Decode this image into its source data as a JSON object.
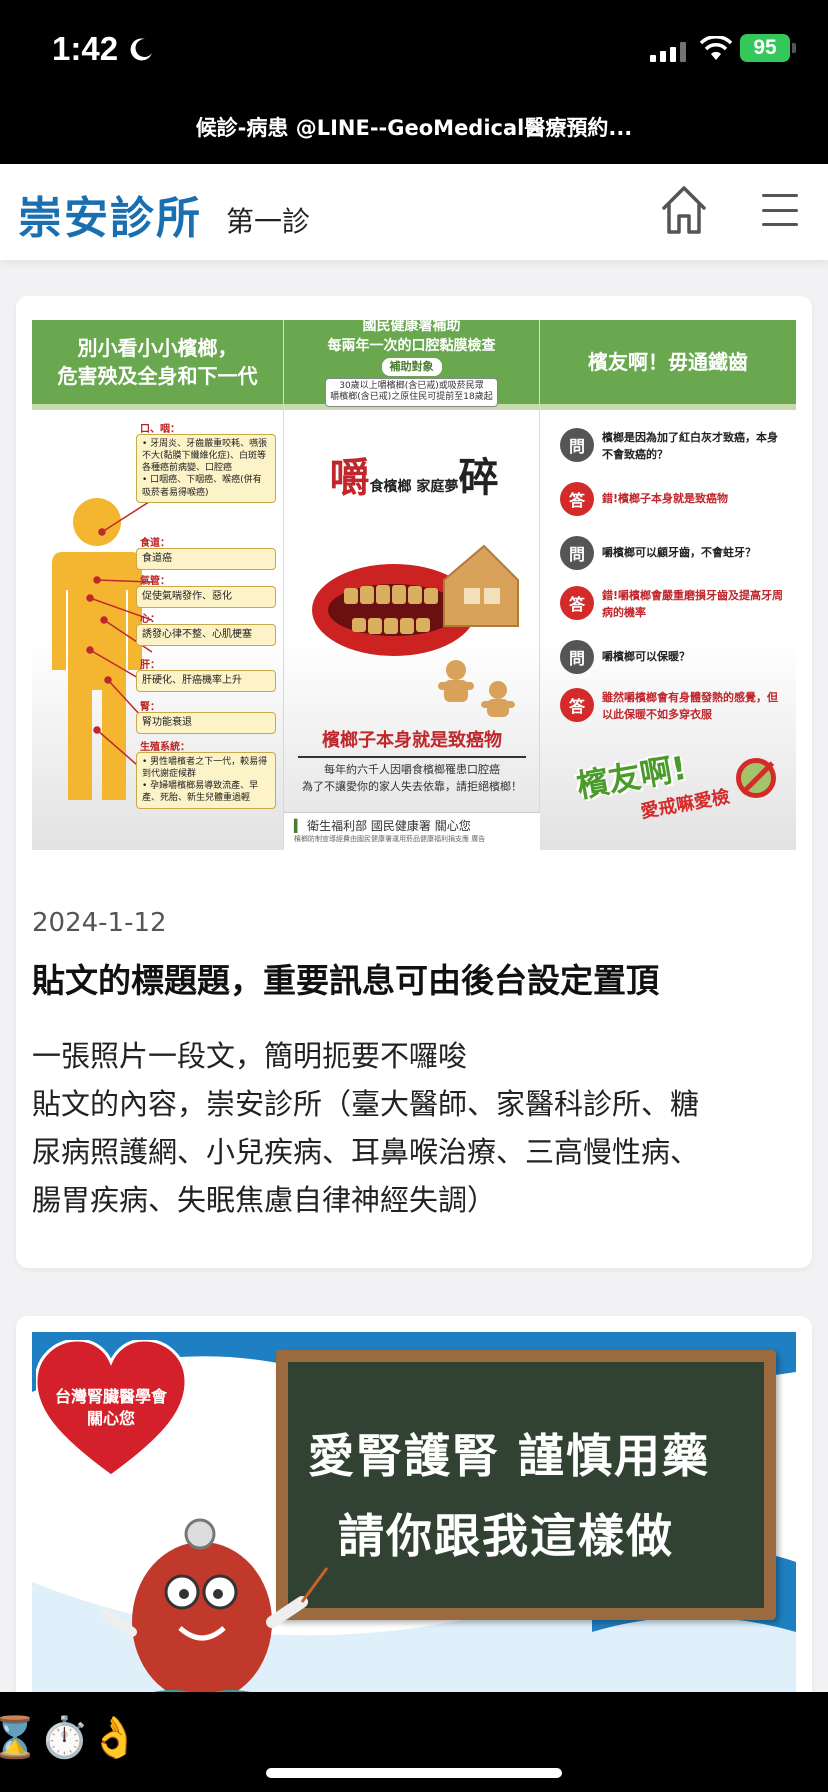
{
  "status_bar": {
    "time": "1:42",
    "battery": "95"
  },
  "browser": {
    "title": "候診-病患 @LINE--GeoMedical醫療預約..."
  },
  "header": {
    "clinic_name": "崇安診所",
    "clinic_sub": "第一診"
  },
  "posts": [
    {
      "date": "2024-1-12",
      "title": "貼文的標題題，重要訊息可由後台設定置頂",
      "body_lines": [
        "一張照片一段文，簡明扼要不囉唆",
        "貼文的內容，崇安診所（臺大醫師、家醫科診所、糖",
        "尿病照護網、小兒疾病、耳鼻喉治療、三高慢性病、",
        "腸胃疾病、失眠焦慮自律神經失調）"
      ],
      "poster": {
        "col1_title_1": "別小看小小檳榔，",
        "col1_title_2": "危害殃及全身和下一代",
        "mouth_label": "口、咽：",
        "mouth_text": "• 牙周炎、牙齒嚴重咬耗、嚥張不大(黏膜下纖維化症)、白斑等各種癌前病變、口腔癌\n• 口咽癌、下咽癌、喉癌(併有吸菸者易得喉癌)",
        "esophagus_label": "食道：",
        "esophagus_text": "食道癌",
        "trachea_label": "氣管：",
        "trachea_text": "促使氣喘發作、惡化",
        "heart_label": "心：",
        "heart_text": "誘發心律不整、心肌梗塞",
        "liver_label": "肝：",
        "liver_text": "肝硬化、肝癌機率上升",
        "kidney_label": "腎：",
        "kidney_text": "腎功能衰退",
        "repro_label": "生殖系統：",
        "repro_text": "• 男性嚼檳者之下一代，較易得到代謝症候群\n• 孕婦嚼檳榔易導致流產、早產、死胎、新生兒體重過輕",
        "col2_title_1": "國民健康署補助",
        "col2_title_2": "每兩年一次的口腔黏膜檢查",
        "col2_tag": "補助對象",
        "col2_note": "30歲以上嚼檳榔(含已戒)或吸菸民眾\n嚼檳榔(含已戒)之原住民可提前至18歲起",
        "headline_big1": "嚼",
        "headline_mid1": "食檳榔 家庭夢",
        "headline_big2": "碎",
        "slogan": "檳榔子本身就是致癌物",
        "small_text": "每年約六千人因嚼食檳榔罹患口腔癌\n為了不讓愛你的家人失去依靠，請拒絕檳榔！",
        "footer_org": "衛生福利部  國民健康署  關心您",
        "footer_small": "檳榔防制宣導經費由國民健康署運用菸品健康福利捐支應  廣告",
        "col3_title": "檳友啊！毋通鐵齒",
        "q_char": "問",
        "a_char": "答",
        "qa": [
          {
            "q": "檳榔是因為加了紅白灰才致癌，本身不會致癌的？",
            "a": "錯!檳榔子本身就是致癌物"
          },
          {
            "q": "嚼檳榔可以顧牙齒，不會蛀牙？",
            "a": "錯!嚼檳榔會嚴重磨損牙齒及提高牙周病的機率"
          },
          {
            "q": "嚼檳榔可以保暖？",
            "a": "雖然嚼檳榔會有身體發熱的感覺，但以此保暖不如多穿衣服"
          }
        ],
        "logo_text": "檳友啊!",
        "logo_sub": "愛戒嘛愛檢"
      }
    },
    {
      "poster": {
        "heart_text": "台灣腎臟醫學會\n關心您",
        "board_line1": "愛腎護腎 謹慎用藥",
        "board_line2": "請你跟我這樣做"
      }
    }
  ],
  "bottom": {
    "emojis": "⌛⏱️👌"
  },
  "colors": {
    "brand": "#1a6fb0",
    "poster_green": "#6aa84f",
    "warning_red": "#d42a2a"
  }
}
